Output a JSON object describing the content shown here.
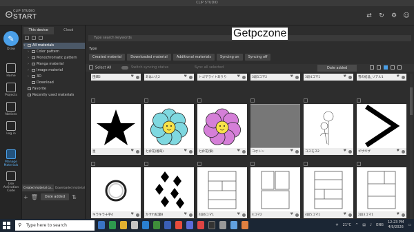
{
  "window": {
    "title": "CLIP STUDIO"
  },
  "header": {
    "logo_small": "CLIP STUDIO",
    "logo_big": "START",
    "icons": [
      "transfer-icon",
      "refresh-icon",
      "gear-icon",
      "account-icon"
    ]
  },
  "leftnav": {
    "items": [
      {
        "label": "Draw",
        "icon": "pen-icon",
        "active": true
      },
      {
        "label": "Home",
        "icon": "home-icon"
      },
      {
        "label": "Projects",
        "icon": "chart-icon"
      },
      {
        "label": "Notices",
        "icon": "bell-icon"
      },
      {
        "label": "Log in",
        "icon": "login-icon"
      },
      {
        "label": "Manage Materials",
        "icon": "materials-icon",
        "active": true
      },
      {
        "label": "Use Activation Code",
        "icon": "code-icon"
      }
    ]
  },
  "tree": {
    "tabs": [
      "This device",
      "Cloud"
    ],
    "nodes": [
      {
        "label": "All materials",
        "level": 0,
        "arrow": "v",
        "selected": true
      },
      {
        "label": "Color pattern",
        "level": 1,
        "arrow": ">"
      },
      {
        "label": "Monochromatic pattern",
        "level": 1,
        "arrow": ">"
      },
      {
        "label": "Manga material",
        "level": 1,
        "arrow": ">"
      },
      {
        "label": "Image material",
        "level": 1,
        "arrow": ">"
      },
      {
        "label": "3D",
        "level": 1,
        "arrow": ">"
      },
      {
        "label": "Download",
        "level": 1,
        "arrow": ""
      },
      {
        "label": "Favorite",
        "level": 0,
        "arrow": ""
      },
      {
        "label": "Recently used materials",
        "level": 0,
        "arrow": ""
      }
    ],
    "bottom_tabs": [
      "Created material ca...",
      "Downloaded material ca..."
    ],
    "sort_label": "Date added"
  },
  "main": {
    "search_placeholder": "Type search keywords",
    "watermark": "Getpczone",
    "type_label": "Type",
    "chips": [
      "Created material",
      "Downloaded material",
      "Additional materials",
      "Syncing on",
      "Syncing off"
    ],
    "select_all": "Select All",
    "switch_sync": "Switch syncing status",
    "sync_all": "Sync all selected",
    "sort_label": "Date added",
    "rows": [
      [
        {
          "name": "田畑2",
          "kind": "photo"
        },
        {
          "name": "あはいえ2",
          "kind": "photo"
        },
        {
          "name": "トゴマライトありり",
          "kind": "photo"
        },
        {
          "name": "3段5コマ2",
          "kind": "photo"
        },
        {
          "name": "3段4コマ1",
          "kind": "photo"
        },
        {
          "name": "雪の結晶_リアル1",
          "kind": "photo"
        }
      ],
      [
        {
          "name": "星",
          "kind": "star"
        },
        {
          "name": "七弁花(着蒔)",
          "kind": "flower-cyan"
        },
        {
          "name": "七弁花(紫)",
          "kind": "flower-pink"
        },
        {
          "name": "コオトン",
          "kind": "lines"
        },
        {
          "name": "コスモス2",
          "kind": "cosmos"
        },
        {
          "name": "ギザギザ",
          "kind": "chevron"
        }
      ],
      [
        {
          "name": "キラキラ十字4",
          "kind": "ring"
        },
        {
          "name": "かすれ紅葉8",
          "kind": "leaves"
        },
        {
          "name": "4段6コマ1",
          "kind": "panels-a"
        },
        {
          "name": "4コマ2",
          "kind": "panels-b"
        },
        {
          "name": "4段5コマ1",
          "kind": "panels-c"
        },
        {
          "name": "2段3コマ1",
          "kind": "panels-d"
        }
      ]
    ]
  },
  "taskbar": {
    "search_placeholder": "Type here to search",
    "weather": "21°C",
    "lang": "ENG",
    "time": "12:23 PM",
    "date": "4/9/2026"
  }
}
